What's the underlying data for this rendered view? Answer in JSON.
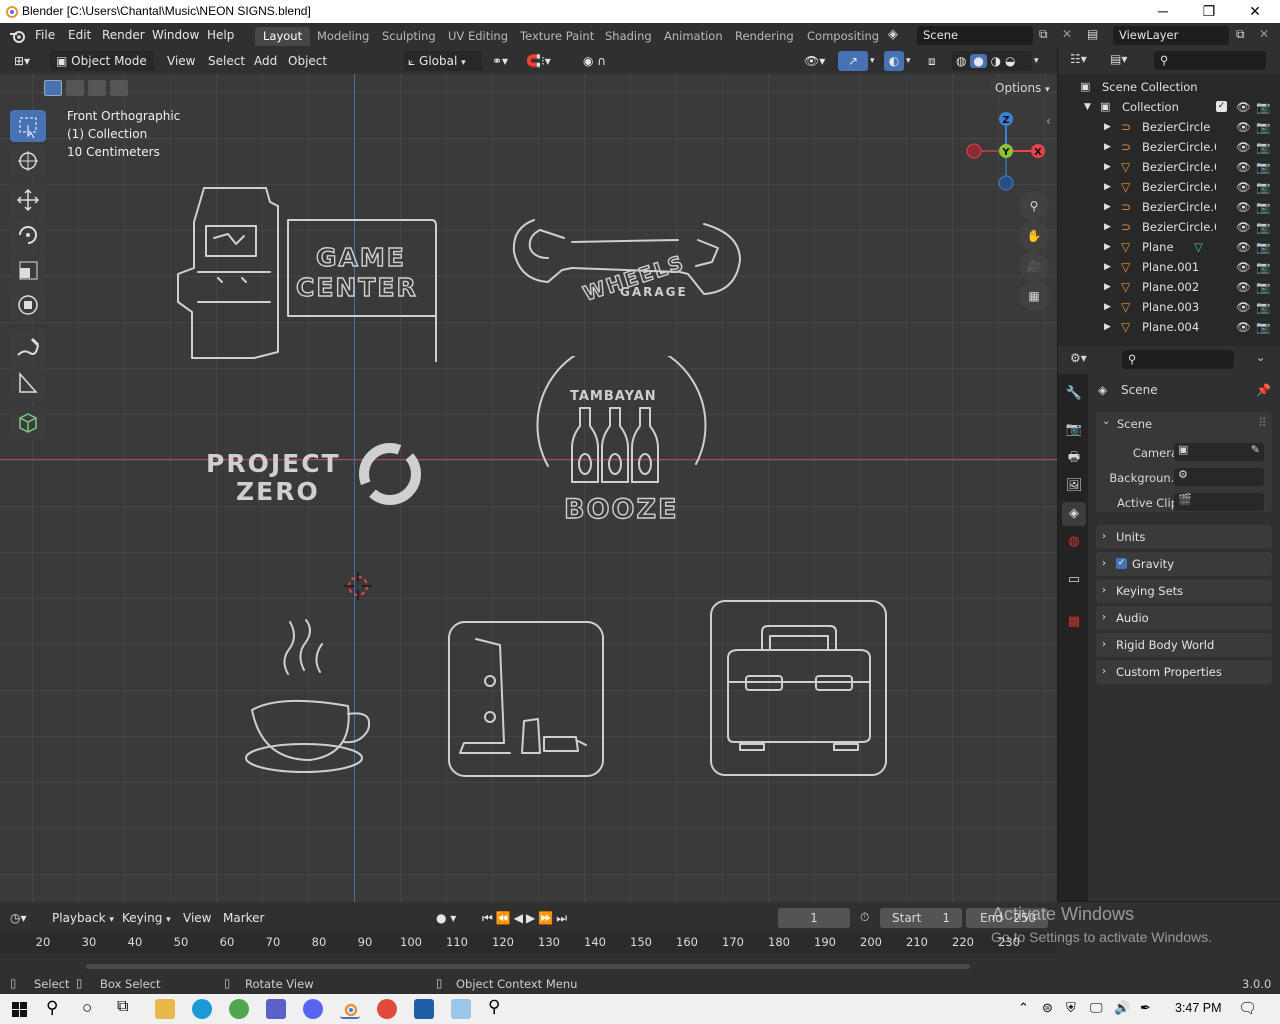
{
  "window": {
    "title": "Blender [C:\\Users\\Chantal\\Music\\NEON SIGNS.blend]",
    "minimize": "─",
    "maximize": "❐",
    "close": "✕"
  },
  "menubar": {
    "items": [
      "File",
      "Edit",
      "Render",
      "Window",
      "Help"
    ],
    "workspaces": [
      "Layout",
      "Modeling",
      "Sculpting",
      "UV Editing",
      "Texture Paint",
      "Shading",
      "Animation",
      "Rendering",
      "Compositing"
    ],
    "active_workspace": "Layout",
    "scene_field": "Scene",
    "view_layer_field": "ViewLayer"
  },
  "viewport_header": {
    "mode": "Object Mode",
    "menus": [
      "View",
      "Select",
      "Add",
      "Object"
    ],
    "transform_orientation": "Global",
    "options_label": "Options"
  },
  "viewport": {
    "view_name": "Front Orthographic",
    "collection_info": "(1) Collection",
    "scale_info": "10 Centimeters",
    "gizmo_axes": {
      "z": "Z",
      "y": "Y",
      "x": "X"
    },
    "signs": {
      "game_center_line1": "GAME",
      "game_center_line2": "CENTER",
      "wheels": "WHEELS",
      "garage": "GARAGE",
      "tambayan": "TAMBAYAN",
      "booze": "BOOZE",
      "project": "PROJECT",
      "zero": "ZERO"
    }
  },
  "outliner": {
    "root": "Scene Collection",
    "collection": "Collection",
    "items": [
      {
        "name": "BezierCircle",
        "icon": "curve-icon"
      },
      {
        "name": "BezierCircle.0",
        "icon": "curve-icon"
      },
      {
        "name": "BezierCircle.0",
        "icon": "mesh-icon"
      },
      {
        "name": "BezierCircle.0",
        "icon": "mesh-icon"
      },
      {
        "name": "BezierCircle.0",
        "icon": "curve-icon"
      },
      {
        "name": "BezierCircle.0",
        "icon": "curve-icon"
      },
      {
        "name": "Plane",
        "icon": "mesh-icon"
      },
      {
        "name": "Plane.001",
        "icon": "mesh-icon"
      },
      {
        "name": "Plane.002",
        "icon": "mesh-icon"
      },
      {
        "name": "Plane.003",
        "icon": "mesh-icon"
      },
      {
        "name": "Plane.004",
        "icon": "mesh-icon"
      }
    ]
  },
  "properties": {
    "context_title": "Scene",
    "panel_title": "Scene",
    "fields": {
      "camera_label": "Camera",
      "background_label": "Backgroun..",
      "active_clip_label": "Active Clip"
    },
    "sections": [
      "Units",
      "Gravity",
      "Keying Sets",
      "Audio",
      "Rigid Body World",
      "Custom Properties"
    ],
    "gravity_checked": true
  },
  "timeline": {
    "menus": [
      "Playback",
      "Keying",
      "View",
      "Marker"
    ],
    "current_frame": "1",
    "start_label": "Start",
    "start_value": "1",
    "end_label": "End",
    "end_value": "250",
    "ruler_ticks": [
      "20",
      "30",
      "40",
      "50",
      "60",
      "70",
      "80",
      "90",
      "100",
      "110",
      "120",
      "130",
      "140",
      "150",
      "160",
      "170",
      "180",
      "190",
      "200",
      "210",
      "220",
      "230"
    ],
    "watermark_line1": "Activate Windows",
    "watermark_line2": "Go to Settings to activate Windows."
  },
  "statusbar": {
    "select": "Select",
    "box_select": "Box Select",
    "rotate_view": "Rotate View",
    "context_menu": "Object Context Menu",
    "version": "3.0.0"
  },
  "taskbar": {
    "time": "3:47 PM"
  },
  "colors": {
    "accent_blue": "#4772b3",
    "axis_x": "#e8424d",
    "axis_y": "#8bc437",
    "axis_z": "#3b80d6",
    "orange_object": "#e8923c"
  }
}
